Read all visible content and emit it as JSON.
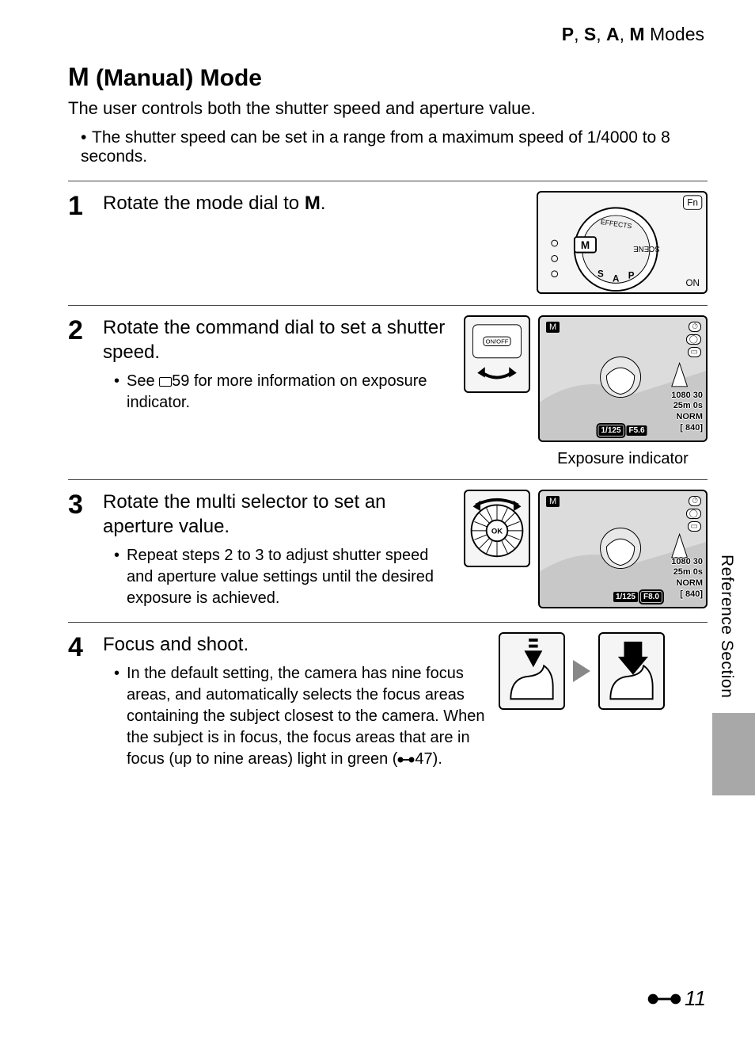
{
  "breadcrumb": {
    "p": "P",
    "s": "S",
    "a": "A",
    "m": "M",
    "suffix": " Modes",
    "sep": ", "
  },
  "heading": {
    "prefix_glyph": "M",
    "text": " (Manual) Mode"
  },
  "intro": "The user controls both the shutter speed and aperture value.",
  "intro_bullet": "The shutter speed can be set in a range from a maximum speed of 1/4000 to 8 seconds.",
  "steps": [
    {
      "num": "1",
      "title_pre": "Rotate the mode dial to ",
      "title_glyph": "M",
      "title_post": ".",
      "bullets": [],
      "fig": {
        "dial": {
          "labels": {
            "fn": "Fn",
            "on": "ON",
            "mode": "M",
            "scene": "SCENE",
            "effects": "EFFECTS",
            "s": "S",
            "a": "A",
            "p": "P"
          }
        }
      }
    },
    {
      "num": "2",
      "title": "Rotate the command dial to set a shutter speed.",
      "bullets": [
        {
          "pre": "See ",
          "ref": "59",
          "post": " for more information on exposure indicator."
        }
      ],
      "fig": {
        "sm_label": "ON/OFF",
        "lcd": {
          "mode_badge": "M",
          "right_stack": [
            "1080 30",
            "25m 0s",
            "NORM",
            "[  840]"
          ],
          "shutter": "1/125",
          "aperture": "F5.6"
        },
        "caption": "Exposure indicator"
      }
    },
    {
      "num": "3",
      "title": "Rotate the multi selector to set an aperture value.",
      "bullets": [
        {
          "text": "Repeat steps 2 to 3 to adjust shutter speed and aperture value settings until the desired exposure is achieved."
        }
      ],
      "fig": {
        "sm_label": "OK",
        "lcd": {
          "mode_badge": "M",
          "right_stack": [
            "1080 30",
            "25m 0s",
            "NORM",
            "[  840]"
          ],
          "shutter": "1/125",
          "aperture": "F8.0"
        }
      }
    },
    {
      "num": "4",
      "title": "Focus and shoot.",
      "bullets": [
        {
          "text_pre": "In the default setting, the camera has nine focus areas, and automatically selects the focus areas containing the subject closest to the camera. When the subject is in focus, the focus areas that are in focus (up to nine areas) light in green (",
          "ref": "47",
          "text_post": ")."
        }
      ]
    }
  ],
  "side_tab": "Reference Section",
  "page_number": "11"
}
